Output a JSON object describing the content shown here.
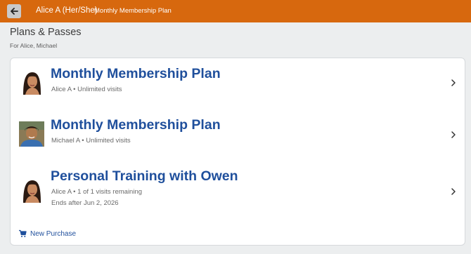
{
  "header": {
    "user_name": "Alice A (Her/She)",
    "plan_name": "Monthly Membership Plan",
    "back_icon": "arrow-left-icon",
    "background_color": "#d7680e"
  },
  "page": {
    "title": "Plans & Passes",
    "subtitle": "For Alice, Michael"
  },
  "plans": [
    {
      "title": "Monthly Membership Plan",
      "holder": "Alice A",
      "detail": "Unlimited visits",
      "extra": "",
      "avatar_icon": "woman-portrait"
    },
    {
      "title": "Monthly Membership Plan",
      "holder": "Michael A",
      "detail": "Unlimited visits",
      "extra": "",
      "avatar_icon": "boy-portrait"
    },
    {
      "title": "Personal Training with Owen",
      "holder": "Alice A",
      "detail": "1 of 1 visits remaining",
      "extra": "Ends after Jun 2, 2026",
      "avatar_icon": "woman-portrait"
    }
  ],
  "footer": {
    "new_purchase_label": "New Purchase",
    "icon": "cart-icon"
  },
  "colors": {
    "accent": "#d7680e",
    "link": "#1f4f9c"
  }
}
